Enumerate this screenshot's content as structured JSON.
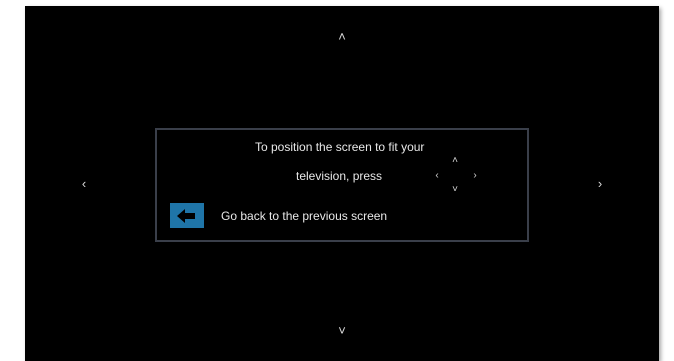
{
  "screen": {
    "arrows": {
      "up": "˄",
      "down": "˅",
      "left": "‹",
      "right": "›"
    }
  },
  "dialog": {
    "line1": "To position the screen to fit your",
    "line2": "television, press",
    "dpad": {
      "up": "˄",
      "down": "˅",
      "left": "‹",
      "right": "›"
    },
    "back_icon": "back-arrow-icon",
    "back_label": "Go back to the previous screen",
    "accent": "#1f75a8",
    "border": "#3a3f4a"
  }
}
